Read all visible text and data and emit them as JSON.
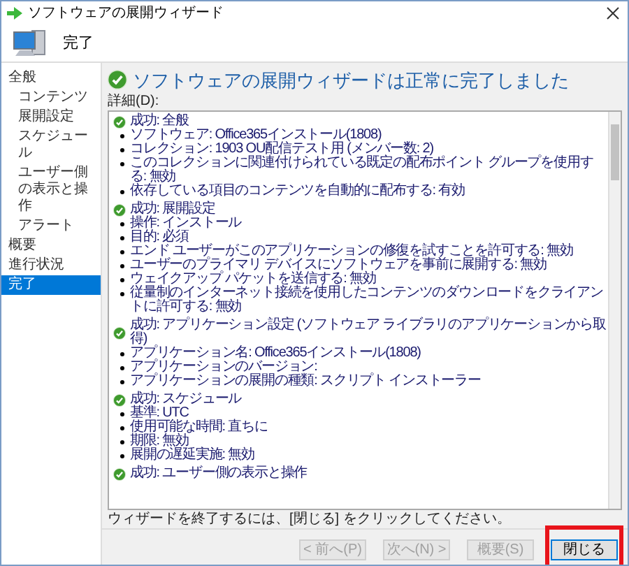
{
  "window": {
    "title": "ソフトウェアの展開ウィザード"
  },
  "header": {
    "title": "完了"
  },
  "nav": {
    "items": [
      {
        "label": "全般",
        "selected": false,
        "children": [
          {
            "label": "コンテンツ",
            "selected": false
          },
          {
            "label": "展開設定",
            "selected": false
          },
          {
            "label": "スケジュール",
            "selected": false
          },
          {
            "label": "ユーザー側の表示と操作",
            "selected": false
          },
          {
            "label": "アラート",
            "selected": false
          }
        ]
      },
      {
        "label": "概要",
        "selected": false
      },
      {
        "label": "進行状況",
        "selected": false
      },
      {
        "label": "完了",
        "selected": true
      }
    ]
  },
  "content": {
    "heading": "ソフトウェアの展開ウィザードは正常に完了しました",
    "details_label": "詳細(D):",
    "sections": [
      {
        "title": "成功: 全般",
        "items": [
          "ソフトウェア: Office365インストール(1808)",
          "コレクション: 1903 OU配信テスト用 (メンバー数: 2)",
          "このコレクションに関連付けられている既定の配布ポイント グループを使用する: 無効",
          "依存している項目のコンテンツを自動的に配布する: 有効"
        ]
      },
      {
        "title": "成功: 展開設定",
        "items": [
          "操作: インストール",
          "目的: 必須",
          "エンド ユーザーがこのアプリケーションの修復を試すことを許可する: 無効",
          "ユーザーのプライマリ デバイスにソフトウェアを事前に展開する: 無効",
          "ウェイクアップ パケットを送信する: 無効",
          "従量制のインターネット接続を使用したコンテンツのダウンロードをクライアントに許可する: 無効"
        ]
      },
      {
        "title": "成功: アプリケーション設定 (ソフトウェア ライブラリのアプリケーションから取得)",
        "items": [
          "アプリケーション名: Office365インストール(1808)",
          "アプリケーションのバージョン:",
          "アプリケーションの展開の種類: スクリプト インストーラー"
        ]
      },
      {
        "title": "成功: スケジュール",
        "items": [
          "基準: UTC",
          "使用可能な時間: 直ちに",
          "期限: 無効",
          "展開の遅延実施: 無効"
        ]
      },
      {
        "title": "成功: ユーザー側の表示と操作"
      }
    ],
    "footer_note": "ウィザードを終了するには、[閉じる] をクリックしてください。"
  },
  "buttons": [
    {
      "label": "< 前へ(P)",
      "disabled": true,
      "highlighted": false
    },
    {
      "label": "次へ(N) >",
      "disabled": true,
      "highlighted": false
    },
    {
      "label": "概要(S)",
      "disabled": true,
      "highlighted": false
    },
    {
      "label": "閉じる",
      "disabled": false,
      "highlighted": true
    }
  ]
}
